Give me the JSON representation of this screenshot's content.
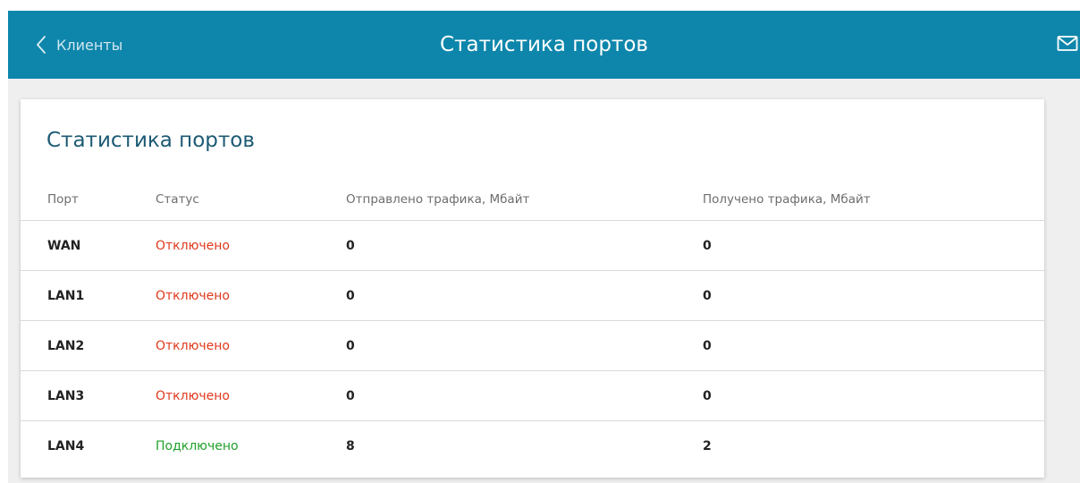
{
  "header": {
    "back_label": "Клиенты",
    "title": "Статистика портов",
    "back_icon": "chevron-left-icon",
    "mail_icon": "envelope-icon",
    "bar_color": "#0e86ab"
  },
  "card": {
    "title": "Статистика портов"
  },
  "table": {
    "columns": [
      "Порт",
      "Статус",
      "Отправлено трафика, Мбайт",
      "Получено трафика, Мбайт"
    ],
    "rows": [
      {
        "port": "WAN",
        "status": "Отключено",
        "connected": false,
        "sent": "0",
        "received": "0"
      },
      {
        "port": "LAN1",
        "status": "Отключено",
        "connected": false,
        "sent": "0",
        "received": "0"
      },
      {
        "port": "LAN2",
        "status": "Отключено",
        "connected": false,
        "sent": "0",
        "received": "0"
      },
      {
        "port": "LAN3",
        "status": "Отключено",
        "connected": false,
        "sent": "0",
        "received": "0"
      },
      {
        "port": "LAN4",
        "status": "Подключено",
        "connected": true,
        "sent": "8",
        "received": "2"
      }
    ]
  },
  "colors": {
    "disconnected": "#e0381b",
    "connected": "#22a12b"
  }
}
